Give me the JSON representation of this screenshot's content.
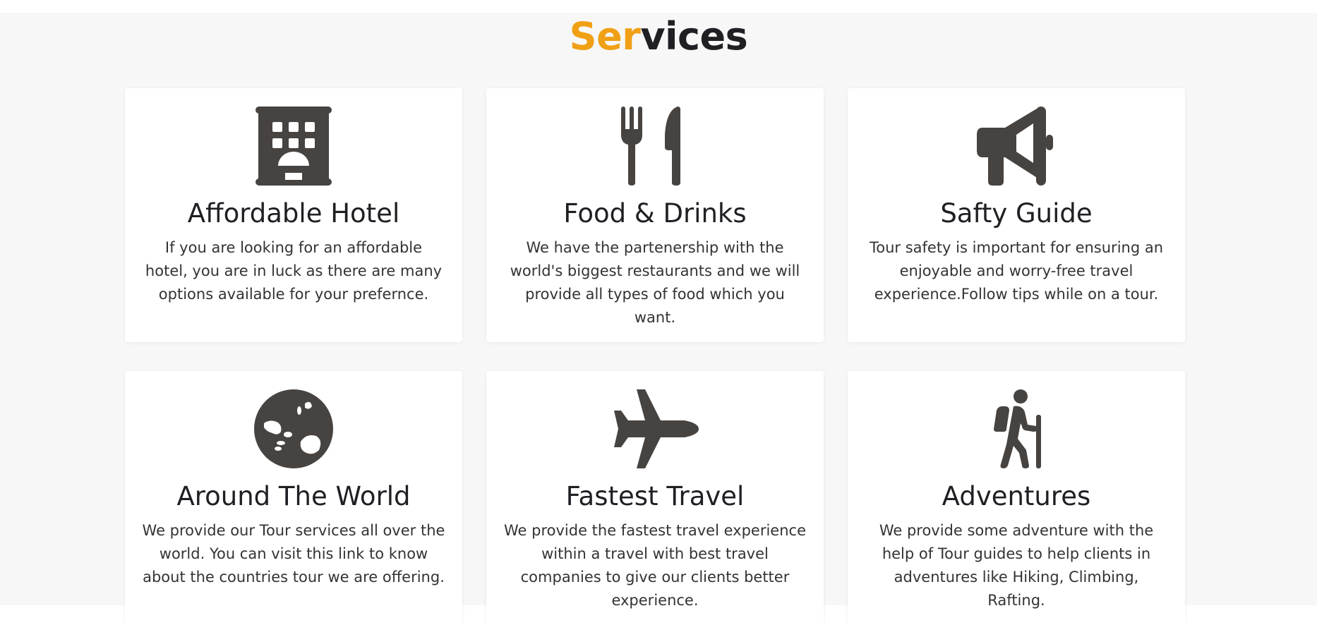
{
  "heading": {
    "accent": "Ser",
    "rest": "vices"
  },
  "colors": {
    "accent": "#f0a014",
    "icon": "#474340",
    "card_bg": "#ffffff",
    "section_bg": "#f7f7f7"
  },
  "services": [
    {
      "icon": "hotel-icon",
      "title": "Affordable Hotel",
      "text": "If you are looking for an affordable hotel, you are in luck as there are many options available for your prefernce."
    },
    {
      "icon": "utensils-icon",
      "title": "Food & Drinks",
      "text": "We have the partenership with the world's biggest restaurants and we will provide all types of food which you want."
    },
    {
      "icon": "megaphone-icon",
      "title": "Safty Guide",
      "text": "Tour safety is important for ensuring an enjoyable and worry-free travel experience.Follow tips while on a tour."
    },
    {
      "icon": "globe-icon",
      "title": "Around The World",
      "text": "We provide our Tour services all over the world. You can visit this link to know about the countries tour we are offering."
    },
    {
      "icon": "plane-icon",
      "title": "Fastest Travel",
      "text": "We provide the fastest travel experience within a travel with best travel companies to give our clients better experience."
    },
    {
      "icon": "hiker-icon",
      "title": "Adventures",
      "text": "We provide some adventure with the help of Tour guides to help clients in adventures like Hiking, Climbing, Rafting."
    }
  ]
}
